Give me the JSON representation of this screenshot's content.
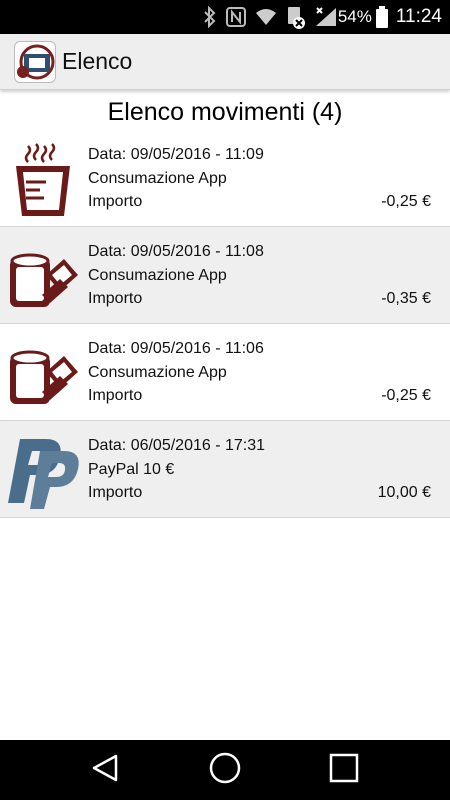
{
  "status_bar": {
    "battery": "54%",
    "time": "11:24"
  },
  "app_bar": {
    "title": "Elenco"
  },
  "list": {
    "title": "Elenco movimenti (4)",
    "items": [
      {
        "icon": "coffee-cup-icon",
        "date": "Data: 09/05/2016 - 11:09",
        "description": "Consumazione App",
        "amount_label": "Importo",
        "amount": "-0,25 €"
      },
      {
        "icon": "vending-ticket-icon",
        "date": "Data: 09/05/2016 - 11:08",
        "description": "Consumazione App",
        "amount_label": "Importo",
        "amount": "-0,35 €"
      },
      {
        "icon": "vending-ticket-icon",
        "date": "Data: 09/05/2016 - 11:06",
        "description": "Consumazione App",
        "amount_label": "Importo",
        "amount": "-0,25 €"
      },
      {
        "icon": "paypal-icon",
        "date": "Data: 06/05/2016 - 17:31",
        "description": "PayPal 10 €",
        "amount_label": "Importo",
        "amount": "10,00 €"
      }
    ]
  },
  "colors": {
    "icon_maroon": "#6b1a1a",
    "paypal_blue": "#4a6d8c",
    "row_alt": "#efefef"
  }
}
